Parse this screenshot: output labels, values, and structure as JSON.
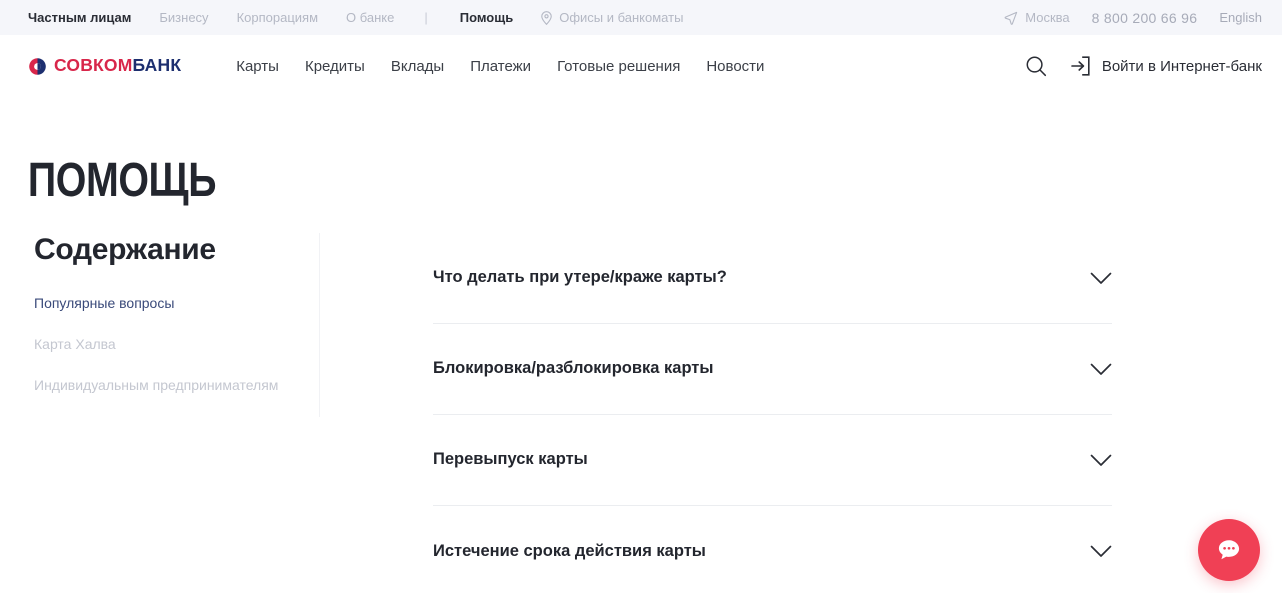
{
  "topbar": {
    "audience_links": [
      {
        "label": "Частным лицам",
        "active": true
      },
      {
        "label": "Бизнесу",
        "active": false
      },
      {
        "label": "Корпорациям",
        "active": false
      },
      {
        "label": "О банке",
        "active": false
      }
    ],
    "separator": "|",
    "help_label": "Помощь",
    "offices_label": "Офисы и банкоматы",
    "city_label": "Москва",
    "phone": "8 800 200 66 96",
    "language": "English"
  },
  "header": {
    "logo": {
      "part_red": "СОВКОМ",
      "part_blue": "БАНК"
    },
    "nav": [
      {
        "label": "Карты"
      },
      {
        "label": "Кредиты"
      },
      {
        "label": "Вклады"
      },
      {
        "label": "Платежи"
      },
      {
        "label": "Готовые решения"
      },
      {
        "label": "Новости"
      }
    ],
    "login_label": "Войти в Интернет-банк",
    "search_icon": "search-icon",
    "login_icon": "sign-in-icon"
  },
  "page": {
    "title": "ПОМОЩЬ"
  },
  "sidebar": {
    "title": "Содержание",
    "items": [
      {
        "label": "Популярные вопросы",
        "active": true
      },
      {
        "label": "Карта Халва",
        "active": false
      },
      {
        "label": "Индивидуальным предпринимателям",
        "active": false
      }
    ]
  },
  "faq": {
    "items": [
      {
        "question": "Что делать при утере/краже карты?"
      },
      {
        "question": "Блокировка/разблокировка карты"
      },
      {
        "question": "Перевыпуск карты"
      },
      {
        "question": "Истечение срока действия карты"
      }
    ]
  },
  "chat": {
    "aria_label": "Чат с поддержкой",
    "color": "#f04055"
  },
  "colors": {
    "topbar_bg": "#f5f6fa",
    "brand_red": "#d8264a",
    "brand_blue": "#1d2f6f",
    "text_dark": "#23262e",
    "text_muted": "#b4b8c4",
    "sidebar_active": "#3a4a7a",
    "divider": "#ebedf0"
  }
}
